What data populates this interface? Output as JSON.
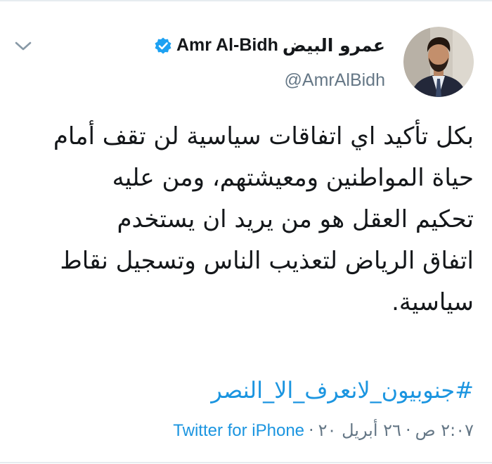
{
  "author": {
    "name_ar": "عمرو البيض",
    "name_en": "Amr Al-Bidh",
    "handle": "@AmrAlBidh",
    "verified": true
  },
  "tweet": {
    "lines": [
      "بكل تأكيد اي اتفاقات سياسية لن تقف أمام",
      "حياة المواطنين ومعيشتهم، ومن عليه",
      "تحكيم العقل هو من يريد ان يستخدم",
      "اتفاق الرياض لتعذيب الناس وتسجيل نقاط",
      "سياسية."
    ],
    "hashtag": "#جنوبيون_لانعرف_الا_النصر"
  },
  "meta": {
    "time": "٢:٠٧ ص",
    "date": "٢٦ أبريل ٢٠",
    "separator": "·",
    "source": "Twitter for iPhone"
  },
  "colors": {
    "text": "#14171a",
    "secondary": "#657786",
    "link": "#1b95e0",
    "verified": "#1da1f2"
  },
  "icons": {
    "menu": "chevron-down-icon",
    "verified": "verified-badge-icon"
  }
}
